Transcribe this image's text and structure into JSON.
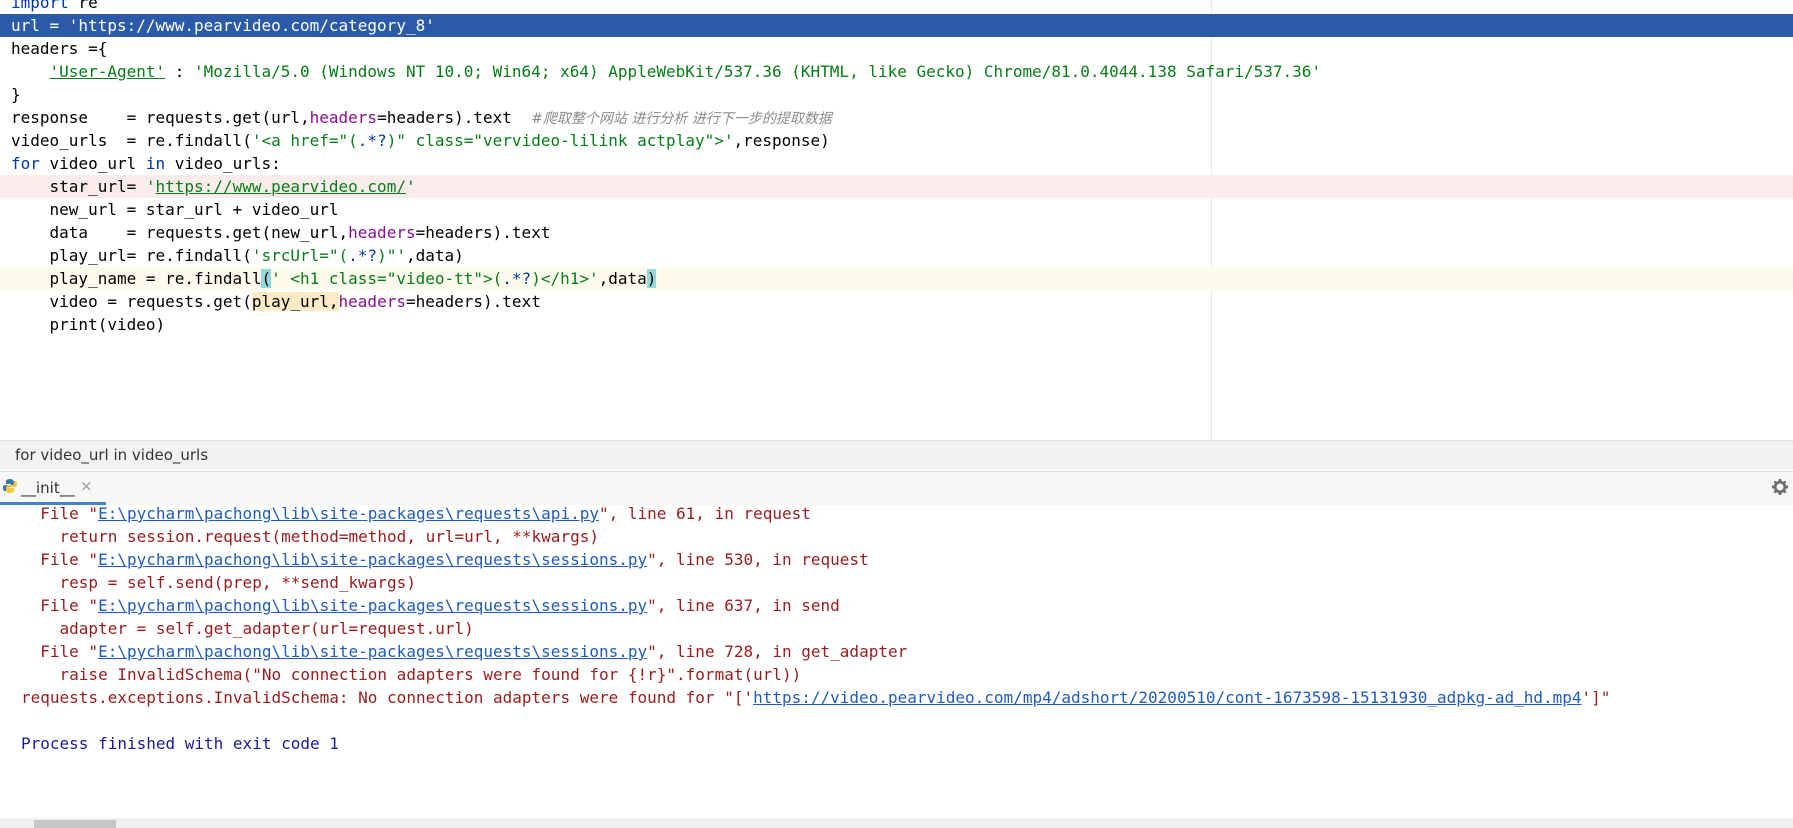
{
  "editor": {
    "lines": [
      {
        "parts": [
          {
            "t": "import",
            "c": "kw"
          },
          {
            "t": " re",
            "c": ""
          }
        ]
      },
      {
        "parts": [
          {
            "t": "url = ",
            "c": ""
          },
          {
            "t": "'https://www.pearvideo.com/category_8'",
            "c": "s"
          }
        ]
      },
      {
        "parts": [
          {
            "t": "headers ={",
            "c": ""
          }
        ]
      },
      {
        "parts": [
          {
            "t": "    ",
            "c": ""
          },
          {
            "t": "'User-Agent'",
            "c": "s u"
          },
          {
            "t": " : ",
            "c": ""
          },
          {
            "t": "'Mozilla/5.0 (Windows NT 10.0; Win64; x64) AppleWebKit/537.36 (KHTML, like Gecko) Chrome/81.0.4044.138 Safari/537.36'",
            "c": "s"
          }
        ]
      },
      {
        "parts": [
          {
            "t": "}",
            "c": ""
          }
        ]
      },
      {
        "parts": [
          {
            "t": "response    = requests.get(url,",
            "c": ""
          },
          {
            "t": "headers",
            "c": "p"
          },
          {
            "t": "=headers).text  ",
            "c": ""
          },
          {
            "t": "#爬取整个网站 进行分析 进行下一步的提取数据",
            "c": "c"
          }
        ]
      },
      {
        "parts": [
          {
            "t": "video_urls  = re.findall(",
            "c": ""
          },
          {
            "t": "'<a href=\"(",
            "c": "s"
          },
          {
            "t": ".*?",
            "c": "esc"
          },
          {
            "t": ")\" class=\"vervideo-lilink actplay\">'",
            "c": "s"
          },
          {
            "t": ",response)",
            "c": ""
          }
        ]
      },
      {
        "parts": [
          {
            "t": "for",
            "c": "kw"
          },
          {
            "t": " video_url ",
            "c": ""
          },
          {
            "t": "in",
            "c": "kw"
          },
          {
            "t": " video_urls:",
            "c": ""
          }
        ]
      },
      {
        "parts": [
          {
            "t": "    star_url= ",
            "c": ""
          },
          {
            "t": "'",
            "c": "s"
          },
          {
            "t": "https://www.pearvideo.com/",
            "c": "s u"
          },
          {
            "t": "'",
            "c": "s"
          }
        ]
      },
      {
        "parts": [
          {
            "t": "    new_url = star_url + video_url",
            "c": ""
          }
        ]
      },
      {
        "parts": [
          {
            "t": "    data    = requests.get(new_url,",
            "c": ""
          },
          {
            "t": "headers",
            "c": "p"
          },
          {
            "t": "=headers).text",
            "c": ""
          }
        ]
      },
      {
        "parts": [
          {
            "t": "    play_url= re.findall(",
            "c": ""
          },
          {
            "t": "'srcUrl=\"(",
            "c": "s"
          },
          {
            "t": ".*?",
            "c": "esc"
          },
          {
            "t": ")\"'",
            "c": "s"
          },
          {
            "t": ",data)",
            "c": ""
          }
        ]
      },
      {
        "parts": [
          {
            "t": "    play_name = re.findall",
            "c": ""
          },
          {
            "t": "(",
            "c": "brace-hl"
          },
          {
            "t": "' <h1 class=\"video-tt\">(",
            "c": "s"
          },
          {
            "t": ".*?",
            "c": "esc"
          },
          {
            "t": ")</h1>'",
            "c": "s"
          },
          {
            "t": ",data",
            "c": ""
          },
          {
            "t": ")",
            "c": "brace-hl"
          }
        ]
      },
      {
        "parts": [
          {
            "t": "    video = requests.get(",
            "c": ""
          },
          {
            "t": "play_url,",
            "c": "arg-hl"
          },
          {
            "t": "headers",
            "c": "p"
          },
          {
            "t": "=headers).text",
            "c": ""
          }
        ]
      },
      {
        "parts": [
          {
            "t": "    print(video)",
            "c": ""
          }
        ]
      }
    ],
    "breadcrumb": "for video_url in video_urls"
  },
  "run_panel": {
    "tab_label": "__init__",
    "tab_close": "×"
  },
  "console": {
    "lines": [
      {
        "cls": "err",
        "parts": [
          {
            "t": "  File \"",
            "c": ""
          },
          {
            "t": "E:\\pycharm\\pachong\\lib\\site-packages\\requests\\api.py",
            "c": "link"
          },
          {
            "t": "\", line 61, in request",
            "c": ""
          }
        ]
      },
      {
        "cls": "err",
        "parts": [
          {
            "t": "    return session.request(method=method, url=url, **kwargs)",
            "c": ""
          }
        ]
      },
      {
        "cls": "err",
        "parts": [
          {
            "t": "  File \"",
            "c": ""
          },
          {
            "t": "E:\\pycharm\\pachong\\lib\\site-packages\\requests\\sessions.py",
            "c": "link"
          },
          {
            "t": "\", line 530, in request",
            "c": ""
          }
        ]
      },
      {
        "cls": "err",
        "parts": [
          {
            "t": "    resp = self.send(prep, **send_kwargs)",
            "c": ""
          }
        ]
      },
      {
        "cls": "err",
        "parts": [
          {
            "t": "  File \"",
            "c": ""
          },
          {
            "t": "E:\\pycharm\\pachong\\lib\\site-packages\\requests\\sessions.py",
            "c": "link"
          },
          {
            "t": "\", line 637, in send",
            "c": ""
          }
        ]
      },
      {
        "cls": "err",
        "parts": [
          {
            "t": "    adapter = self.get_adapter(url=request.url)",
            "c": ""
          }
        ]
      },
      {
        "cls": "err",
        "parts": [
          {
            "t": "  File \"",
            "c": ""
          },
          {
            "t": "E:\\pycharm\\pachong\\lib\\site-packages\\requests\\sessions.py",
            "c": "link"
          },
          {
            "t": "\", line 728, in get_adapter",
            "c": ""
          }
        ]
      },
      {
        "cls": "err",
        "parts": [
          {
            "t": "    raise InvalidSchema(\"No connection adapters were found for {!r}\".format(url))",
            "c": ""
          }
        ]
      },
      {
        "cls": "err",
        "parts": [
          {
            "t": "requests.exceptions.InvalidSchema: No connection adapters were found for \"['",
            "c": ""
          },
          {
            "t": "https://video.pearvideo.com/mp4/adshort/20200510/cont-1673598-15131930_adpkg-ad_hd.mp4",
            "c": "link"
          },
          {
            "t": "']\"",
            "c": ""
          }
        ]
      },
      {
        "cls": "err",
        "parts": [
          {
            "t": "",
            "c": ""
          }
        ]
      },
      {
        "cls": "ok",
        "parts": [
          {
            "t": "Process finished with exit code 1",
            "c": ""
          }
        ]
      }
    ]
  },
  "icons": {
    "tab_icon": "python-icon",
    "settings": "gear-icon"
  },
  "colors": {
    "selection": "#2a5aa8",
    "breakpoint_line": "#fbecec",
    "current_line": "#fdfbee",
    "keyword": "#0033b3",
    "string": "#067d17",
    "error_text": "#9a1b1b",
    "link": "#1f5bc0"
  }
}
